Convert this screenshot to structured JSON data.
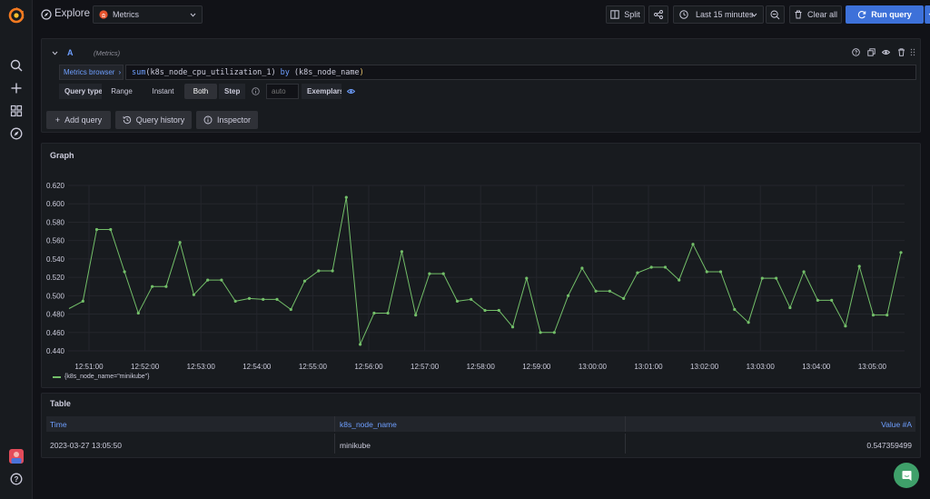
{
  "header": {
    "title": "Explore",
    "datasource": "Metrics",
    "split_label": "Split",
    "time_range": "Last 15 minutes",
    "clear_label": "Clear all",
    "run_label": "Run query"
  },
  "query": {
    "letter": "A",
    "datasource_hint": "(Metrics)",
    "metrics_browser_label": "Metrics browser",
    "expression": {
      "fn": "sum",
      "metric": "k8s_node_cpu_utilization_1",
      "by": "by",
      "label": "k8s_node_name"
    },
    "query_type_label": "Query type",
    "types": [
      "Range",
      "Instant",
      "Both"
    ],
    "selected_type": "Both",
    "step_label": "Step",
    "step_placeholder": "auto",
    "exemplars_label": "Exemplars"
  },
  "actions": {
    "add_query": "Add query",
    "query_history": "Query history",
    "inspector": "Inspector"
  },
  "graph": {
    "title": "Graph",
    "legend": "{k8s_node_name=\"minikube\"}",
    "line_color": "#73bf69"
  },
  "chart_data": {
    "type": "line",
    "title": "Graph",
    "ylim": [
      0.44,
      0.62
    ],
    "y_ticks": [
      "0.440",
      "0.460",
      "0.480",
      "0.500",
      "0.520",
      "0.540",
      "0.560",
      "0.580",
      "0.600",
      "0.620"
    ],
    "x_ticks": [
      "12:51:00",
      "12:52:00",
      "12:53:00",
      "12:54:00",
      "12:55:00",
      "12:56:00",
      "12:57:00",
      "12:58:00",
      "12:59:00",
      "13:00:00",
      "13:01:00",
      "13:02:00",
      "13:03:00",
      "13:04:00",
      "13:05:00"
    ],
    "grid": true,
    "legend": "bottom-left",
    "series": [
      {
        "name": "{k8s_node_name=\"minikube\"}",
        "values": [
          0.486,
          0.494,
          0.572,
          0.572,
          0.526,
          0.481,
          0.51,
          0.51,
          0.558,
          0.501,
          0.517,
          0.517,
          0.494,
          0.497,
          0.496,
          0.496,
          0.485,
          0.516,
          0.527,
          0.527,
          0.607,
          0.447,
          0.481,
          0.481,
          0.548,
          0.479,
          0.524,
          0.524,
          0.494,
          0.496,
          0.484,
          0.484,
          0.466,
          0.519,
          0.46,
          0.46,
          0.5,
          0.53,
          0.505,
          0.505,
          0.497,
          0.525,
          0.531,
          0.531,
          0.517,
          0.556,
          0.526,
          0.526,
          0.485,
          0.471,
          0.519,
          0.519,
          0.487,
          0.526,
          0.495,
          0.495,
          0.467,
          0.532,
          0.479,
          0.479,
          0.547
        ]
      }
    ]
  },
  "table": {
    "title": "Table",
    "columns": [
      "Time",
      "k8s_node_name",
      "Value #A"
    ],
    "rows": [
      [
        "2023-03-27 13:05:50",
        "minikube",
        "0.547359499"
      ]
    ]
  }
}
